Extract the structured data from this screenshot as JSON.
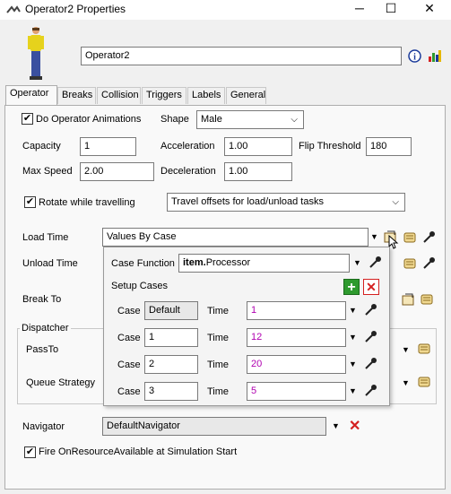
{
  "window": {
    "title": "Operator2  Properties"
  },
  "header": {
    "name_value": "Operator2"
  },
  "tabs": [
    "Operator",
    "Breaks",
    "Collision",
    "Triggers",
    "Labels",
    "General"
  ],
  "operator": {
    "animations_label": "Do Operator Animations",
    "shape_label": "Shape",
    "shape_value": "Male",
    "capacity_label": "Capacity",
    "capacity_value": "1",
    "acceleration_label": "Acceleration",
    "acceleration_value": "1.00",
    "flip_label": "Flip Threshold",
    "flip_value": "180",
    "maxspeed_label": "Max Speed",
    "maxspeed_value": "2.00",
    "deceleration_label": "Deceleration",
    "deceleration_value": "1.00",
    "rotate_label": "Rotate while travelling",
    "travel_offsets_value": "Travel offsets for load/unload tasks",
    "loadtime_label": "Load Time",
    "loadtime_value": "Values By Case",
    "unloadtime_label": "Unload Time",
    "breakto_label": "Break To",
    "dispatcher_label": "Dispatcher",
    "passto_label": "PassTo",
    "queue_label": "Queue Strategy",
    "navigator_label": "Navigator",
    "navigator_value": "DefaultNavigator",
    "fire_label": "Fire OnResourceAvailable at Simulation Start"
  },
  "popup": {
    "case_function_label": "Case Function",
    "case_function_bold": "item.",
    "case_function_rest": "Processor",
    "setup_label": "Setup Cases",
    "case_label": "Case",
    "time_label": "Time",
    "rows": [
      {
        "case": "Default",
        "time": "1"
      },
      {
        "case": "1",
        "time": "12"
      },
      {
        "case": "2",
        "time": "20"
      },
      {
        "case": "3",
        "time": "5"
      }
    ]
  },
  "colors": {
    "accent_magenta": "#b000b0",
    "delete_red": "#d42020",
    "add_green": "#2e9a2e"
  }
}
